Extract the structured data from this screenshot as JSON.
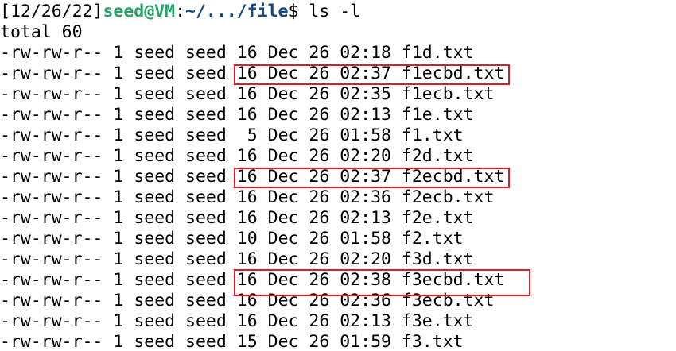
{
  "prompt": {
    "date": "[12/26/22]",
    "user_host": "seed@VM",
    "colon": ":",
    "path": "~/.../file",
    "dollar": "$ ",
    "command": "ls -l"
  },
  "total_line": "total 60",
  "listing": [
    {
      "perms": "-rw-rw-r--",
      "links": "1",
      "owner": "seed",
      "group": "seed",
      "size": "16",
      "date": "Dec 26 02:18",
      "name": "f1d.txt",
      "highlighted": false
    },
    {
      "perms": "-rw-rw-r--",
      "links": "1",
      "owner": "seed",
      "group": "seed",
      "size": "16",
      "date": "Dec 26 02:37",
      "name": "f1ecbd.txt",
      "highlighted": true
    },
    {
      "perms": "-rw-rw-r--",
      "links": "1",
      "owner": "seed",
      "group": "seed",
      "size": "16",
      "date": "Dec 26 02:35",
      "name": "f1ecb.txt",
      "highlighted": false
    },
    {
      "perms": "-rw-rw-r--",
      "links": "1",
      "owner": "seed",
      "group": "seed",
      "size": "16",
      "date": "Dec 26 02:13",
      "name": "f1e.txt",
      "highlighted": false
    },
    {
      "perms": "-rw-rw-r--",
      "links": "1",
      "owner": "seed",
      "group": "seed",
      "size": " 5",
      "date": "Dec 26 01:58",
      "name": "f1.txt",
      "highlighted": false
    },
    {
      "perms": "-rw-rw-r--",
      "links": "1",
      "owner": "seed",
      "group": "seed",
      "size": "16",
      "date": "Dec 26 02:20",
      "name": "f2d.txt",
      "highlighted": false
    },
    {
      "perms": "-rw-rw-r--",
      "links": "1",
      "owner": "seed",
      "group": "seed",
      "size": "16",
      "date": "Dec 26 02:37",
      "name": "f2ecbd.txt",
      "highlighted": true
    },
    {
      "perms": "-rw-rw-r--",
      "links": "1",
      "owner": "seed",
      "group": "seed",
      "size": "16",
      "date": "Dec 26 02:36",
      "name": "f2ecb.txt",
      "highlighted": false
    },
    {
      "perms": "-rw-rw-r--",
      "links": "1",
      "owner": "seed",
      "group": "seed",
      "size": "16",
      "date": "Dec 26 02:13",
      "name": "f2e.txt",
      "highlighted": false
    },
    {
      "perms": "-rw-rw-r--",
      "links": "1",
      "owner": "seed",
      "group": "seed",
      "size": "10",
      "date": "Dec 26 01:58",
      "name": "f2.txt",
      "highlighted": false
    },
    {
      "perms": "-rw-rw-r--",
      "links": "1",
      "owner": "seed",
      "group": "seed",
      "size": "16",
      "date": "Dec 26 02:20",
      "name": "f3d.txt",
      "highlighted": false
    },
    {
      "perms": "-rw-rw-r--",
      "links": "1",
      "owner": "seed",
      "group": "seed",
      "size": "16",
      "date": "Dec 26 02:38",
      "name": "f3ecbd.txt",
      "highlighted": true
    },
    {
      "perms": "-rw-rw-r--",
      "links": "1",
      "owner": "seed",
      "group": "seed",
      "size": "16",
      "date": "Dec 26 02:36",
      "name": "f3ecb.txt",
      "highlighted": false
    },
    {
      "perms": "-rw-rw-r--",
      "links": "1",
      "owner": "seed",
      "group": "seed",
      "size": "16",
      "date": "Dec 26 02:13",
      "name": "f3e.txt",
      "highlighted": false
    },
    {
      "perms": "-rw-rw-r--",
      "links": "1",
      "owner": "seed",
      "group": "seed",
      "size": "15",
      "date": "Dec 26 01:59",
      "name": "f3.txt",
      "highlighted": false
    }
  ],
  "colors": {
    "prompt_user": "#26a269",
    "prompt_path": "#12488b",
    "highlight_border": "#e01b24",
    "background": "#ffffff",
    "text": "#000000"
  }
}
